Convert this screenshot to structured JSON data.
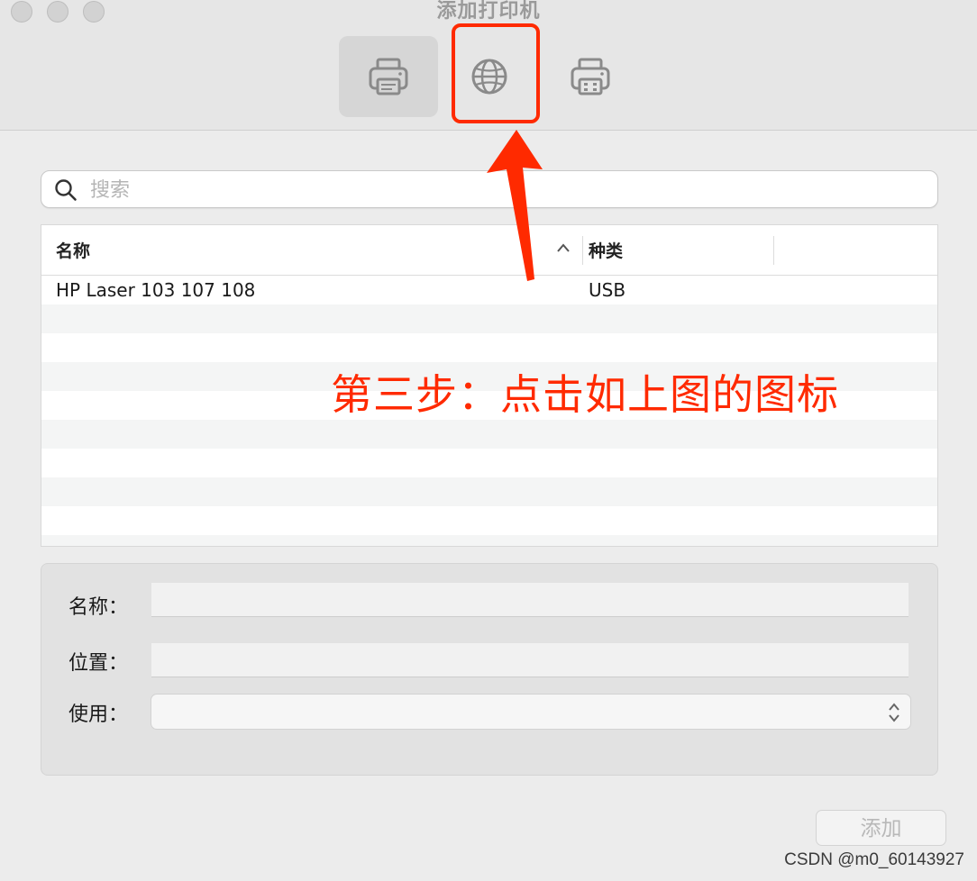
{
  "window": {
    "title": "添加打印机",
    "traffic_lights": [
      "close",
      "minimize",
      "zoom"
    ]
  },
  "toolbar": {
    "buttons": [
      {
        "icon": "printer-default-icon",
        "selected": true
      },
      {
        "icon": "globe-ip-icon",
        "selected": false,
        "highlighted": true
      },
      {
        "icon": "printer-windows-icon",
        "selected": false
      }
    ]
  },
  "search": {
    "placeholder": "搜索",
    "value": ""
  },
  "table": {
    "columns": [
      "名称",
      "种类"
    ],
    "sort": {
      "column": "名称",
      "direction": "ascending"
    },
    "rows": [
      {
        "name": "HP Laser 103 107 108",
        "kind": "USB"
      }
    ]
  },
  "annotation": {
    "text": "第三步：点击如上图的图标",
    "color": "#ff2a00"
  },
  "form": {
    "name_label": "名称：",
    "name_value": "",
    "location_label": "位置：",
    "location_value": "",
    "use_label": "使用：",
    "use_value": ""
  },
  "actions": {
    "add_label": "添加"
  },
  "watermark": "CSDN @m0_60143927",
  "colors": {
    "accent_red": "#ff2a00",
    "window_bg": "#ececec",
    "row_alt": "#f4f5f5"
  }
}
